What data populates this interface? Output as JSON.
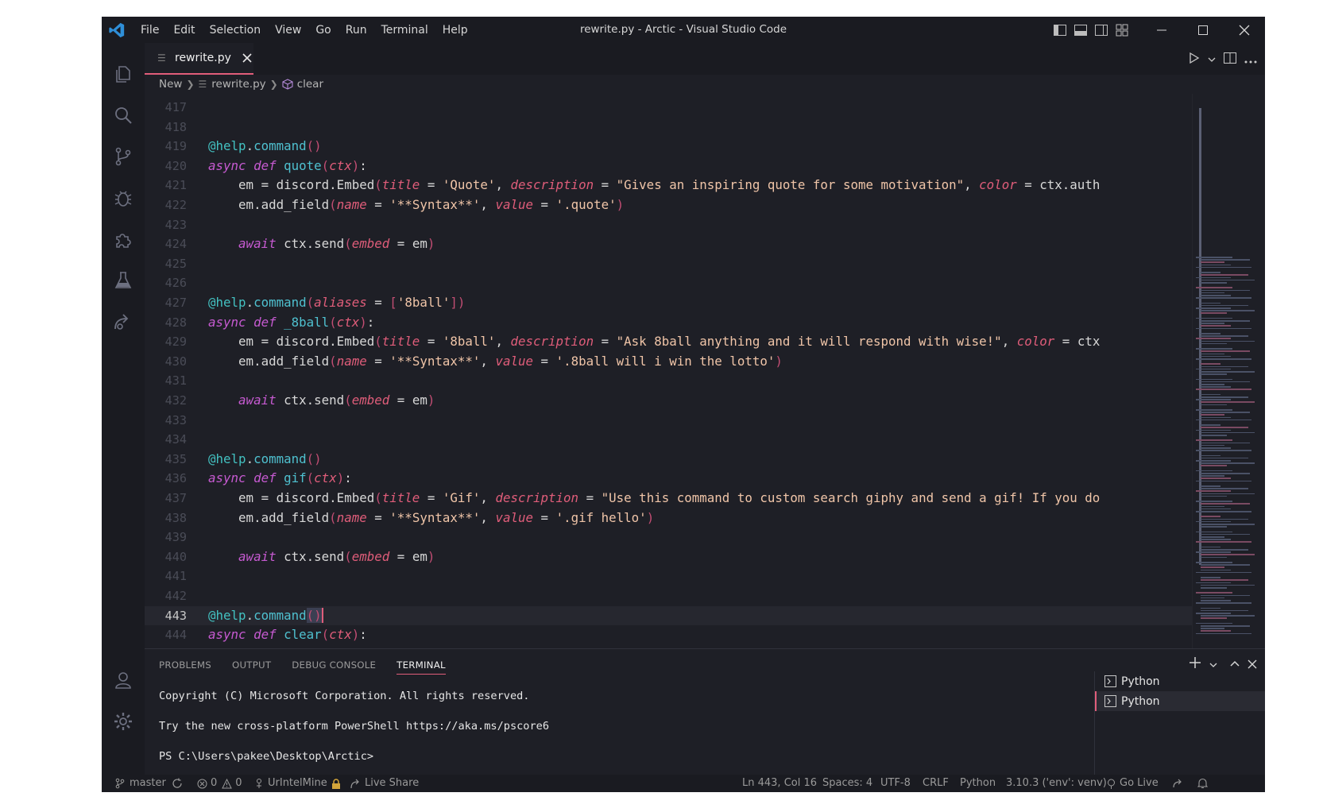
{
  "window_title": "rewrite.py - Arctic - Visual Studio Code",
  "menu": [
    "File",
    "Edit",
    "Selection",
    "View",
    "Go",
    "Run",
    "Terminal",
    "Help"
  ],
  "tab": {
    "label": "rewrite.py"
  },
  "breadcrumb": {
    "folder": "New",
    "file": "rewrite.py",
    "symbol": "clear"
  },
  "code_lines": [
    {
      "num": "417",
      "tokens": []
    },
    {
      "num": "418",
      "tokens": []
    },
    {
      "num": "419",
      "tokens": [
        [
          "at",
          "@help"
        ],
        [
          "def",
          "."
        ],
        [
          "fn",
          "command"
        ],
        [
          "br",
          "()"
        ]
      ]
    },
    {
      "num": "420",
      "tokens": [
        [
          "kw",
          "async def "
        ],
        [
          "fn",
          "quote"
        ],
        [
          "br",
          "("
        ],
        [
          "par",
          "ctx"
        ],
        [
          "br",
          ")"
        ],
        [
          "def",
          ":"
        ]
      ]
    },
    {
      "num": "421",
      "tokens": [
        [
          "def",
          "    em = discord.Embed"
        ],
        [
          "br",
          "("
        ],
        [
          "par",
          "title"
        ],
        [
          "def",
          " = "
        ],
        [
          "str",
          "'Quote'"
        ],
        [
          "def",
          ", "
        ],
        [
          "par",
          "description"
        ],
        [
          "def",
          " = "
        ],
        [
          "str",
          "\"Gives an inspiring quote for some motivation\""
        ],
        [
          "def",
          ", "
        ],
        [
          "par",
          "color"
        ],
        [
          "def",
          " = ctx.auth"
        ]
      ]
    },
    {
      "num": "422",
      "tokens": [
        [
          "def",
          "    em.add_field"
        ],
        [
          "br",
          "("
        ],
        [
          "par",
          "name"
        ],
        [
          "def",
          " = "
        ],
        [
          "str",
          "'**Syntax**'"
        ],
        [
          "def",
          ", "
        ],
        [
          "par",
          "value"
        ],
        [
          "def",
          " = "
        ],
        [
          "str",
          "'.quote'"
        ],
        [
          "br",
          ")"
        ]
      ]
    },
    {
      "num": "423",
      "tokens": []
    },
    {
      "num": "424",
      "tokens": [
        [
          "kw",
          "    await "
        ],
        [
          "def",
          "ctx.send"
        ],
        [
          "br",
          "("
        ],
        [
          "par",
          "embed"
        ],
        [
          "def",
          " = em"
        ],
        [
          "br",
          ")"
        ]
      ]
    },
    {
      "num": "425",
      "tokens": []
    },
    {
      "num": "426",
      "tokens": []
    },
    {
      "num": "427",
      "tokens": [
        [
          "at",
          "@help"
        ],
        [
          "def",
          "."
        ],
        [
          "fn",
          "command"
        ],
        [
          "br",
          "("
        ],
        [
          "par",
          "aliases"
        ],
        [
          "def",
          " = "
        ],
        [
          "br",
          "["
        ],
        [
          "str",
          "'8ball'"
        ],
        [
          "br",
          "])"
        ]
      ]
    },
    {
      "num": "428",
      "tokens": [
        [
          "kw",
          "async def "
        ],
        [
          "fn",
          "_8ball"
        ],
        [
          "br",
          "("
        ],
        [
          "par",
          "ctx"
        ],
        [
          "br",
          ")"
        ],
        [
          "def",
          ":"
        ]
      ]
    },
    {
      "num": "429",
      "tokens": [
        [
          "def",
          "    em = discord.Embed"
        ],
        [
          "br",
          "("
        ],
        [
          "par",
          "title"
        ],
        [
          "def",
          " = "
        ],
        [
          "str",
          "'8ball'"
        ],
        [
          "def",
          ", "
        ],
        [
          "par",
          "description"
        ],
        [
          "def",
          " = "
        ],
        [
          "str",
          "\"Ask 8ball anything and it will respond with wise!\""
        ],
        [
          "def",
          ", "
        ],
        [
          "par",
          "color"
        ],
        [
          "def",
          " = ctx"
        ]
      ]
    },
    {
      "num": "430",
      "tokens": [
        [
          "def",
          "    em.add_field"
        ],
        [
          "br",
          "("
        ],
        [
          "par",
          "name"
        ],
        [
          "def",
          " = "
        ],
        [
          "str",
          "'**Syntax**'"
        ],
        [
          "def",
          ", "
        ],
        [
          "par",
          "value"
        ],
        [
          "def",
          " = "
        ],
        [
          "str",
          "'.8ball will i win the lotto'"
        ],
        [
          "br",
          ")"
        ]
      ]
    },
    {
      "num": "431",
      "tokens": []
    },
    {
      "num": "432",
      "tokens": [
        [
          "kw",
          "    await "
        ],
        [
          "def",
          "ctx.send"
        ],
        [
          "br",
          "("
        ],
        [
          "par",
          "embed"
        ],
        [
          "def",
          " = em"
        ],
        [
          "br",
          ")"
        ]
      ]
    },
    {
      "num": "433",
      "tokens": []
    },
    {
      "num": "434",
      "tokens": []
    },
    {
      "num": "435",
      "tokens": [
        [
          "at",
          "@help"
        ],
        [
          "def",
          "."
        ],
        [
          "fn",
          "command"
        ],
        [
          "br",
          "()"
        ]
      ]
    },
    {
      "num": "436",
      "tokens": [
        [
          "kw",
          "async def "
        ],
        [
          "fn",
          "gif"
        ],
        [
          "br",
          "("
        ],
        [
          "par",
          "ctx"
        ],
        [
          "br",
          ")"
        ],
        [
          "def",
          ":"
        ]
      ]
    },
    {
      "num": "437",
      "tokens": [
        [
          "def",
          "    em = discord.Embed"
        ],
        [
          "br",
          "("
        ],
        [
          "par",
          "title"
        ],
        [
          "def",
          " = "
        ],
        [
          "str",
          "'Gif'"
        ],
        [
          "def",
          ", "
        ],
        [
          "par",
          "description"
        ],
        [
          "def",
          " = "
        ],
        [
          "str",
          "\"Use this command to custom search giphy and send a gif! If you do"
        ]
      ]
    },
    {
      "num": "438",
      "tokens": [
        [
          "def",
          "    em.add_field"
        ],
        [
          "br",
          "("
        ],
        [
          "par",
          "name"
        ],
        [
          "def",
          " = "
        ],
        [
          "str",
          "'**Syntax**'"
        ],
        [
          "def",
          ", "
        ],
        [
          "par",
          "value"
        ],
        [
          "def",
          " = "
        ],
        [
          "str",
          "'.gif hello'"
        ],
        [
          "br",
          ")"
        ]
      ]
    },
    {
      "num": "439",
      "tokens": []
    },
    {
      "num": "440",
      "tokens": [
        [
          "kw",
          "    await "
        ],
        [
          "def",
          "ctx.send"
        ],
        [
          "br",
          "("
        ],
        [
          "par",
          "embed"
        ],
        [
          "def",
          " = em"
        ],
        [
          "br",
          ")"
        ]
      ]
    },
    {
      "num": "441",
      "tokens": []
    },
    {
      "num": "442",
      "tokens": []
    },
    {
      "num": "443",
      "active": true,
      "tokens": [
        [
          "at",
          "@help"
        ],
        [
          "def",
          "."
        ],
        [
          "fn",
          "command"
        ],
        [
          "hl",
          "()"
        ]
      ]
    },
    {
      "num": "444",
      "tokens": [
        [
          "kw",
          "async def "
        ],
        [
          "fn",
          "clear"
        ],
        [
          "br",
          "("
        ],
        [
          "par",
          "ctx"
        ],
        [
          "br",
          ")"
        ],
        [
          "def",
          ":"
        ]
      ]
    }
  ],
  "panel": {
    "tabs": [
      "PROBLEMS",
      "OUTPUT",
      "DEBUG CONSOLE",
      "TERMINAL"
    ],
    "active_tab": "TERMINAL",
    "terminal_lines": [
      "Copyright (C) Microsoft Corporation. All rights reserved.",
      "Try the new cross-platform PowerShell https://aka.ms/pscore6",
      "PS C:\\Users\\pakee\\Desktop\\Arctic>"
    ],
    "terminals": [
      "Python",
      "Python"
    ]
  },
  "status": {
    "branch": "master",
    "errors": "0",
    "warnings": "0",
    "account": "UrIntelMine",
    "live_share": "Live Share",
    "position": "Ln 443, Col 16",
    "spaces": "Spaces: 4",
    "encoding": "UTF-8",
    "eol": "CRLF",
    "language": "Python",
    "interpreter": "3.10.3 ('env': venv)",
    "go_live": "Go Live"
  },
  "colors": {
    "accent": "#e05d7a",
    "keyword": "#c65ad1",
    "function": "#4fc1d0",
    "string": "#f0c5a8",
    "background": "#1e1f26"
  }
}
